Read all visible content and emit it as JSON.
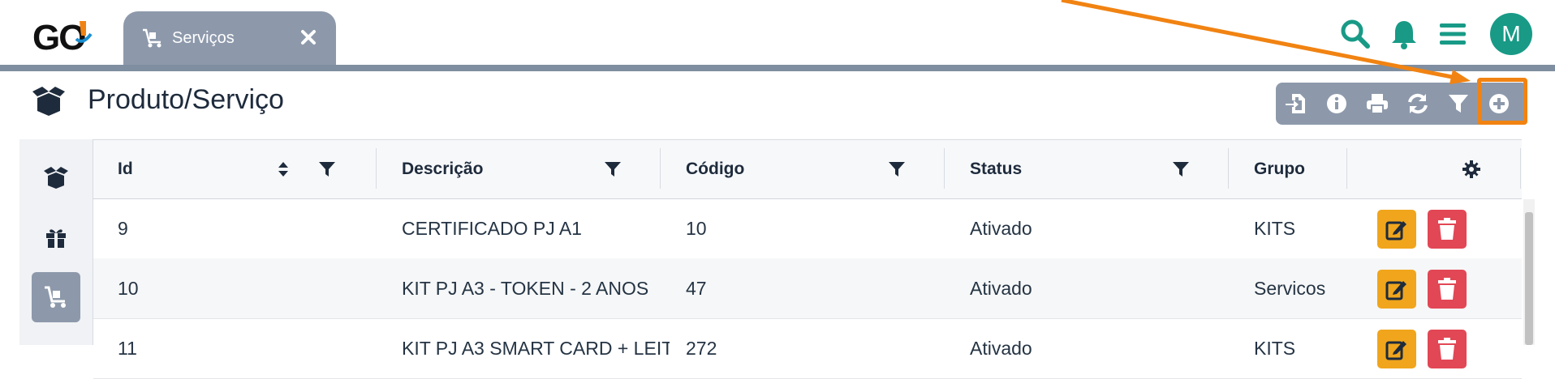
{
  "app": {
    "logo_text": "GO"
  },
  "tab": {
    "label": "Serviços"
  },
  "user": {
    "initial": "M"
  },
  "page": {
    "title": "Produto/Serviço"
  },
  "colors": {
    "accent": "#189a86",
    "toolbar": "#8d99ab",
    "highlight": "#f18312",
    "edit": "#f0a51c",
    "delete": "#e24755"
  },
  "toolbar": {
    "buttons": [
      "import-icon",
      "info-icon",
      "print-icon",
      "refresh-icon",
      "filter-icon",
      "add-icon"
    ]
  },
  "sidebar": {
    "items": [
      "box-icon",
      "gift-icon",
      "service-cart-icon"
    ]
  },
  "table": {
    "columns": [
      "Id",
      "Descrição",
      "Código",
      "Status",
      "Grupo"
    ],
    "rows": [
      {
        "id": "9",
        "descricao": "CERTIFICADO PJ A1",
        "codigo": "10",
        "status": "Ativado",
        "grupo": "KITS"
      },
      {
        "id": "10",
        "descricao": "KIT PJ A3 - TOKEN - 2 ANOS",
        "codigo": "47",
        "status": "Ativado",
        "grupo": "Servicos"
      },
      {
        "id": "11",
        "descricao": "KIT PJ A3 SMART CARD + LEIT",
        "codigo": "272",
        "status": "Ativado",
        "grupo": "KITS"
      }
    ]
  }
}
